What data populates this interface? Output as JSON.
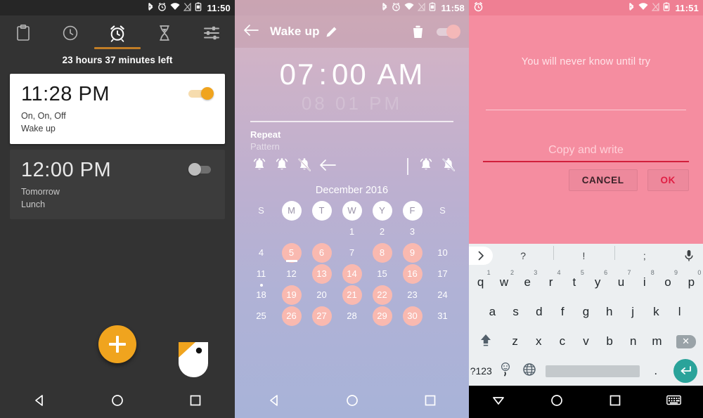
{
  "panel1": {
    "statusbar": {
      "icons": [
        "bluetooth-icon",
        "alarm-icon",
        "wifi-icon",
        "signal-off-icon",
        "battery-icon"
      ],
      "time": "11:50"
    },
    "tabs": [
      {
        "name": "notes",
        "icon": "clipboard-icon",
        "active": false
      },
      {
        "name": "clock",
        "icon": "clock-icon",
        "active": false
      },
      {
        "name": "alarm",
        "icon": "alarm-clock-icon",
        "active": true
      },
      {
        "name": "timer",
        "icon": "hourglass-icon",
        "active": false
      },
      {
        "name": "settings",
        "icon": "sliders-icon",
        "active": false
      }
    ],
    "countdown": "23 hours 37 minutes  left",
    "alarms": [
      {
        "time": "11:28 PM",
        "repeat": "On, On, Off",
        "label": "Wake up",
        "enabled": true
      },
      {
        "time": "12:00 PM",
        "repeat": "Tomorrow",
        "label": "Lunch",
        "enabled": false
      }
    ],
    "fab": "add-alarm-button",
    "brandmark": "app-logo-icon",
    "nav": [
      "back-icon",
      "home-icon",
      "recents-icon"
    ]
  },
  "panel2": {
    "statusbar": {
      "icons": [
        "bluetooth-icon",
        "alarm-icon",
        "wifi-icon",
        "signal-off-icon",
        "battery-icon"
      ],
      "time": "11:58"
    },
    "appbar": {
      "back": "back-arrow-icon",
      "title": "Wake up",
      "edit": "pencil-icon",
      "delete": "trash-icon",
      "toggle_on": true
    },
    "time": {
      "hour": "07",
      "colon": ":",
      "minute": "00",
      "meridiem": "AM"
    },
    "time_ghost": "08   01   PM",
    "repeat": {
      "label": "Repeat",
      "value": "Pattern"
    },
    "bells_left": [
      "bell-on-icon",
      "bell-on-icon",
      "bell-off-icon",
      "back-arrow-icon"
    ],
    "bells_right": [
      "bell-on-icon",
      "bell-off-icon"
    ],
    "month": "December 2016",
    "calendar": {
      "headers": [
        "S",
        "M",
        "T",
        "W",
        "Y",
        "F",
        "S"
      ],
      "header_circled": [
        false,
        true,
        true,
        true,
        true,
        true,
        false
      ],
      "weeks": [
        [
          "",
          "",
          "",
          "1",
          "2",
          "3",
          ""
        ],
        [
          "4",
          "5",
          "6",
          "7",
          "8",
          "9",
          "10"
        ],
        [
          "11",
          "12",
          "13",
          "14",
          "15",
          "16",
          "17"
        ],
        [
          "18",
          "19",
          "20",
          "21",
          "22",
          "23",
          "24"
        ],
        [
          "25",
          "26",
          "27",
          "28",
          "29",
          "30",
          "31"
        ]
      ],
      "selected": [
        "5",
        "6",
        "8",
        "9",
        "13",
        "14",
        "16",
        "19",
        "21",
        "22",
        "26",
        "27",
        "29",
        "30"
      ],
      "underlined": "5",
      "dotted": "18"
    },
    "nav": [
      "back-icon",
      "home-icon",
      "recents-icon"
    ]
  },
  "panel3": {
    "statusbar": {
      "left_icon": "alarm-clock-icon",
      "icons": [
        "bluetooth-icon",
        "wifi-icon",
        "signal-off-icon",
        "battery-icon"
      ],
      "time": "11:51"
    },
    "quote": "You will never know until try",
    "input_placeholder": "Copy and write",
    "buttons": {
      "cancel": "CANCEL",
      "ok": "OK"
    },
    "keyboard": {
      "suggestions": [
        "?",
        "!",
        ";"
      ],
      "expand_icon": "chevron-right-icon",
      "mic_icon": "microphone-icon",
      "row1": [
        {
          "k": "q",
          "n": "1"
        },
        {
          "k": "w",
          "n": "2"
        },
        {
          "k": "e",
          "n": "3"
        },
        {
          "k": "r",
          "n": "4"
        },
        {
          "k": "t",
          "n": "5"
        },
        {
          "k": "y",
          "n": "6"
        },
        {
          "k": "u",
          "n": "7"
        },
        {
          "k": "i",
          "n": "8"
        },
        {
          "k": "o",
          "n": "9"
        },
        {
          "k": "p",
          "n": "0"
        }
      ],
      "row2": [
        "a",
        "s",
        "d",
        "f",
        "g",
        "h",
        "j",
        "k",
        "l"
      ],
      "row3": [
        "z",
        "x",
        "c",
        "v",
        "b",
        "n",
        "m"
      ],
      "shift_icon": "shift-icon",
      "backspace_icon": "backspace-icon",
      "sym_key": "?123",
      "emoji_key": ",",
      "globe_icon": "globe-icon",
      "period_key": ".",
      "enter_icon": "enter-icon"
    },
    "nav": [
      "hide-keyboard-icon",
      "home-icon",
      "recents-icon",
      "keyboard-switch-icon"
    ]
  },
  "colors": {
    "accent_orange": "#f0a41e",
    "panel3_pink": "#f58da0",
    "ok_red": "#e01f44",
    "enter_teal": "#2aa39a",
    "calendar_select": "#f9b9b0"
  }
}
